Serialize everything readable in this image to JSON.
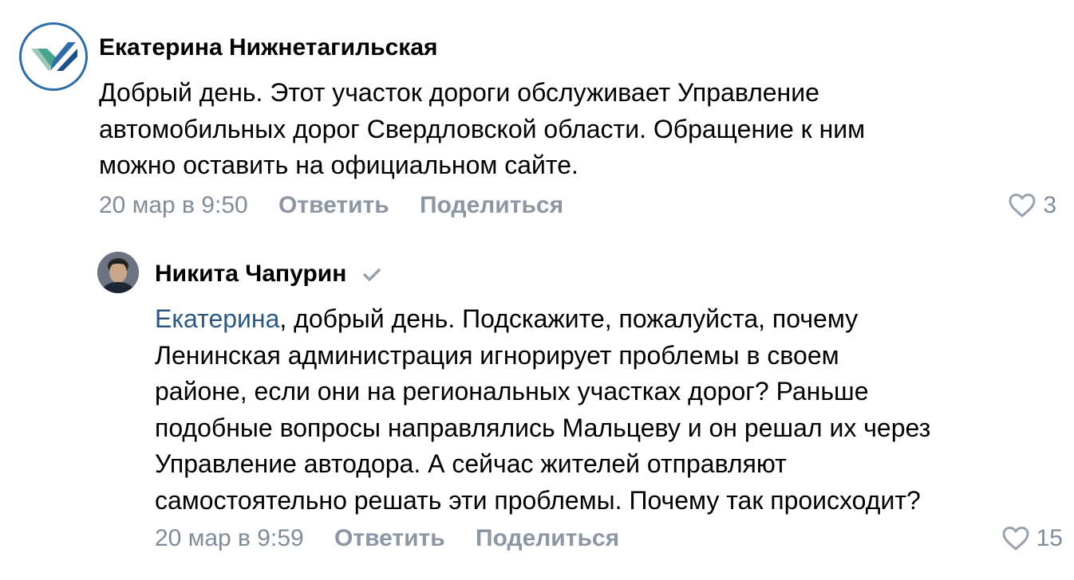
{
  "comments": [
    {
      "author": "Екатерина Нижнетагильская",
      "text_lines": [
        "Добрый день. Этот участок дороги обслуживает Управление",
        "автомобильных дорог Свердловской области. Обращение к ним",
        "можно оставить на официальном сайте."
      ],
      "timestamp": "20 мар в 9:50",
      "reply_label": "Ответить",
      "share_label": "Поделиться",
      "likes": "3",
      "avatar_icon": "logo-icon"
    },
    {
      "author": "Никита Чапурин",
      "verified": true,
      "mention": "Екатерина",
      "text_lines": [
        ", добрый день. Подскажите, пожалуйста, почему",
        "Ленинская администрация игнорирует проблемы в своем",
        "районе, если они на региональных участках дорог? Раньше",
        "подобные вопросы направлялись Мальцеву и он решал их через",
        "Управление автодора. А сейчас жителей отправляют",
        "самостоятельно решать эти проблемы. Почему так происходит?"
      ],
      "timestamp": "20 мар в 9:59",
      "reply_label": "Ответить",
      "share_label": "Поделиться",
      "likes": "15",
      "avatar_icon": "user-photo"
    }
  ],
  "colors": {
    "meta": "#818c99",
    "mention": "#2a5885",
    "logo_blue": "#2f6da8",
    "logo_green": "#4aa38c"
  }
}
